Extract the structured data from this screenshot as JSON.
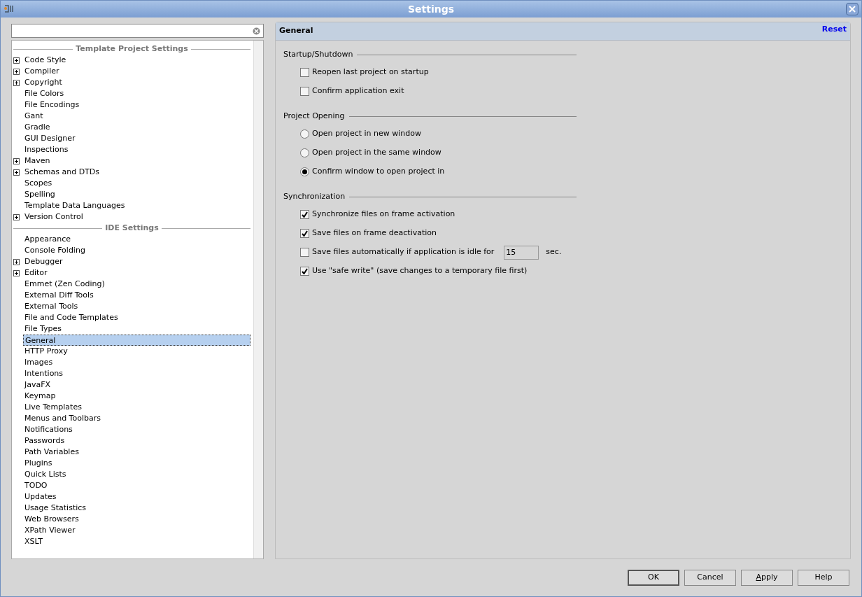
{
  "window": {
    "title": "Settings"
  },
  "tree": [
    {
      "header": "Template Project Settings",
      "items": [
        {
          "label": "Code Style",
          "expanded": false,
          "selected": false
        },
        {
          "label": "Compiler",
          "expanded": false,
          "selected": false
        },
        {
          "label": "Copyright",
          "expanded": false,
          "selected": false
        },
        {
          "label": "File Colors",
          "selected": false
        },
        {
          "label": "File Encodings",
          "selected": false
        },
        {
          "label": "Gant",
          "selected": false
        },
        {
          "label": "Gradle",
          "selected": false
        },
        {
          "label": "GUI Designer",
          "selected": false
        },
        {
          "label": "Inspections",
          "selected": false
        },
        {
          "label": "Maven",
          "expanded": false,
          "selected": false
        },
        {
          "label": "Schemas and DTDs",
          "expanded": false,
          "selected": false
        },
        {
          "label": "Scopes",
          "selected": false
        },
        {
          "label": "Spelling",
          "selected": false
        },
        {
          "label": "Template Data Languages",
          "selected": false
        },
        {
          "label": "Version Control",
          "expanded": false,
          "selected": false
        }
      ]
    },
    {
      "header": "IDE Settings",
      "items": [
        {
          "label": "Appearance",
          "selected": false
        },
        {
          "label": "Console Folding",
          "selected": false
        },
        {
          "label": "Debugger",
          "expanded": false,
          "selected": false
        },
        {
          "label": "Editor",
          "expanded": false,
          "selected": false
        },
        {
          "label": "Emmet (Zen Coding)",
          "selected": false
        },
        {
          "label": "External Diff Tools",
          "selected": false
        },
        {
          "label": "External Tools",
          "selected": false
        },
        {
          "label": "File and Code Templates",
          "selected": false
        },
        {
          "label": "File Types",
          "selected": false
        },
        {
          "label": "General",
          "selected": true
        },
        {
          "label": "HTTP Proxy",
          "selected": false
        },
        {
          "label": "Images",
          "selected": false
        },
        {
          "label": "Intentions",
          "selected": false
        },
        {
          "label": "JavaFX",
          "selected": false
        },
        {
          "label": "Keymap",
          "selected": false
        },
        {
          "label": "Live Templates",
          "selected": false
        },
        {
          "label": "Menus and Toolbars",
          "selected": false
        },
        {
          "label": "Notifications",
          "selected": false
        },
        {
          "label": "Passwords",
          "selected": false
        },
        {
          "label": "Path Variables",
          "selected": false
        },
        {
          "label": "Plugins",
          "selected": false
        },
        {
          "label": "Quick Lists",
          "selected": false
        },
        {
          "label": "TODO",
          "selected": false
        },
        {
          "label": "Updates",
          "selected": false
        },
        {
          "label": "Usage Statistics",
          "selected": false
        },
        {
          "label": "Web Browsers",
          "selected": false
        },
        {
          "label": "XPath Viewer",
          "selected": false
        },
        {
          "label": "XSLT",
          "selected": false
        }
      ]
    }
  ],
  "panel": {
    "title": "General",
    "reset": "Reset",
    "groups": [
      {
        "title": "Startup/Shutdown",
        "options": [
          {
            "kind": "checkbox",
            "label": "Reopen last project on startup",
            "checked": false
          },
          {
            "kind": "checkbox",
            "label": "Confirm application exit",
            "checked": false
          }
        ]
      },
      {
        "title": "Project Opening",
        "options": [
          {
            "kind": "radio",
            "label": "Open project in new window",
            "selected": false
          },
          {
            "kind": "radio",
            "label": "Open project in the same window",
            "selected": false
          },
          {
            "kind": "radio",
            "label": "Confirm window to open project in",
            "selected": true
          }
        ]
      },
      {
        "title": "Synchronization",
        "options": [
          {
            "kind": "checkbox",
            "label": "Synchronize files on frame activation",
            "checked": true
          },
          {
            "kind": "checkbox",
            "label": "Save files on frame deactivation",
            "checked": true
          },
          {
            "kind": "checkbox-field",
            "label": "Save files automatically if application is idle for",
            "checked": false,
            "value": "15",
            "unit": "sec."
          },
          {
            "kind": "checkbox",
            "label": "Use \"safe write\" (save changes to a temporary file first)",
            "checked": true
          }
        ]
      }
    ]
  },
  "buttons": [
    {
      "label": "OK",
      "default": true,
      "mnemonic": false
    },
    {
      "label": "Cancel",
      "default": false,
      "mnemonic": false
    },
    {
      "label": "Apply",
      "default": false,
      "mnemonic": true
    },
    {
      "label": "Help",
      "default": false,
      "mnemonic": false
    }
  ]
}
